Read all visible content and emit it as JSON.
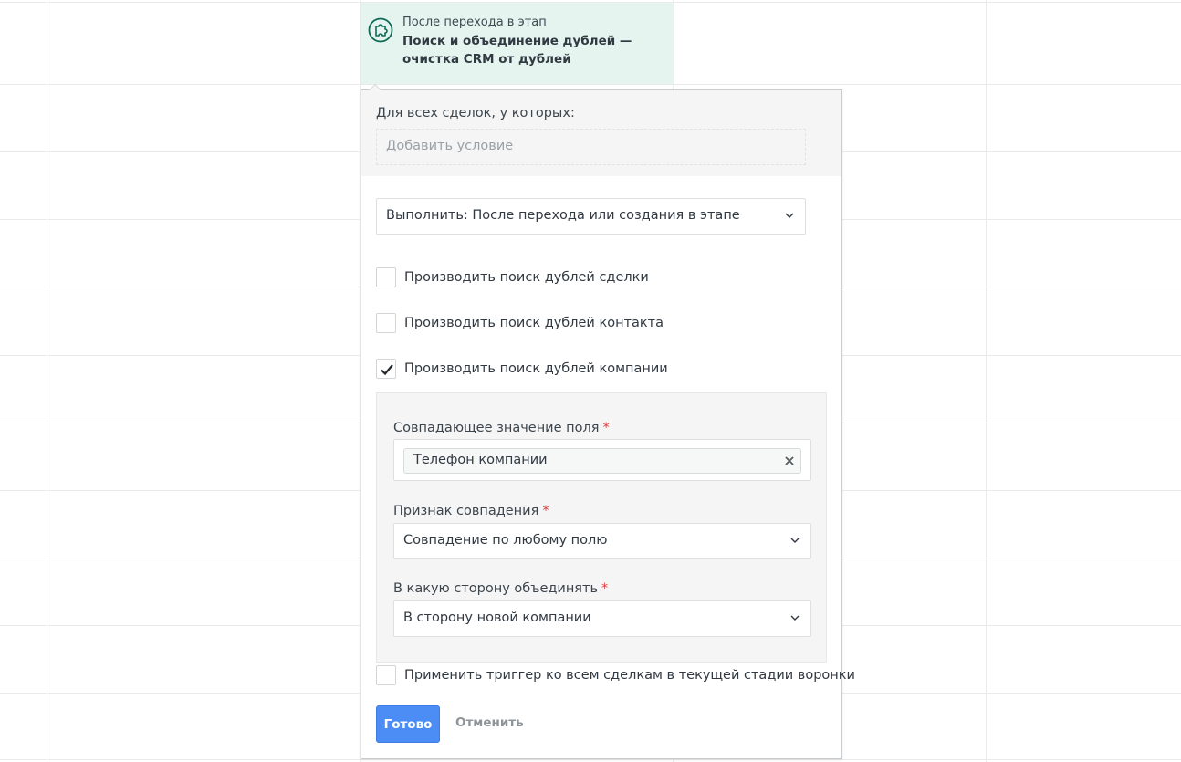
{
  "trigger": {
    "subtitle": "После перехода в этап",
    "title": "Поиск и объединение дублей — очистка CRM от дублей",
    "icon": "puzzle-icon",
    "accent": "#0d6b56",
    "background": "#e5f4ee"
  },
  "conditions": {
    "label": "Для всех сделок, у которых:",
    "add_placeholder": "Добавить условие"
  },
  "execute": {
    "selected": "Выполнить: После перехода или создания в этапе"
  },
  "options": [
    {
      "label": "Производить поиск дублей сделки",
      "checked": false
    },
    {
      "label": "Производить поиск дублей контакта",
      "checked": false
    },
    {
      "label": "Производить поиск дублей компании",
      "checked": true
    }
  ],
  "settings": {
    "match_field": {
      "label": "Совпадающее значение поля",
      "required_mark": "*",
      "tag": "Телефон компании"
    },
    "match_type": {
      "label": "Признак совпадения",
      "required_mark": "*",
      "selected": "Совпадение по любому полю"
    },
    "merge_direction": {
      "label": "В какую сторону объединять",
      "required_mark": "*",
      "selected": "В сторону новой компании"
    }
  },
  "apply_all": {
    "label": "Применить триггер ко всем сделкам в текущей стадии воронки",
    "checked": false
  },
  "buttons": {
    "done": "Готово",
    "cancel": "Отменить"
  },
  "colors": {
    "primary": "#4b8cf5",
    "required": "#e23a3a"
  }
}
